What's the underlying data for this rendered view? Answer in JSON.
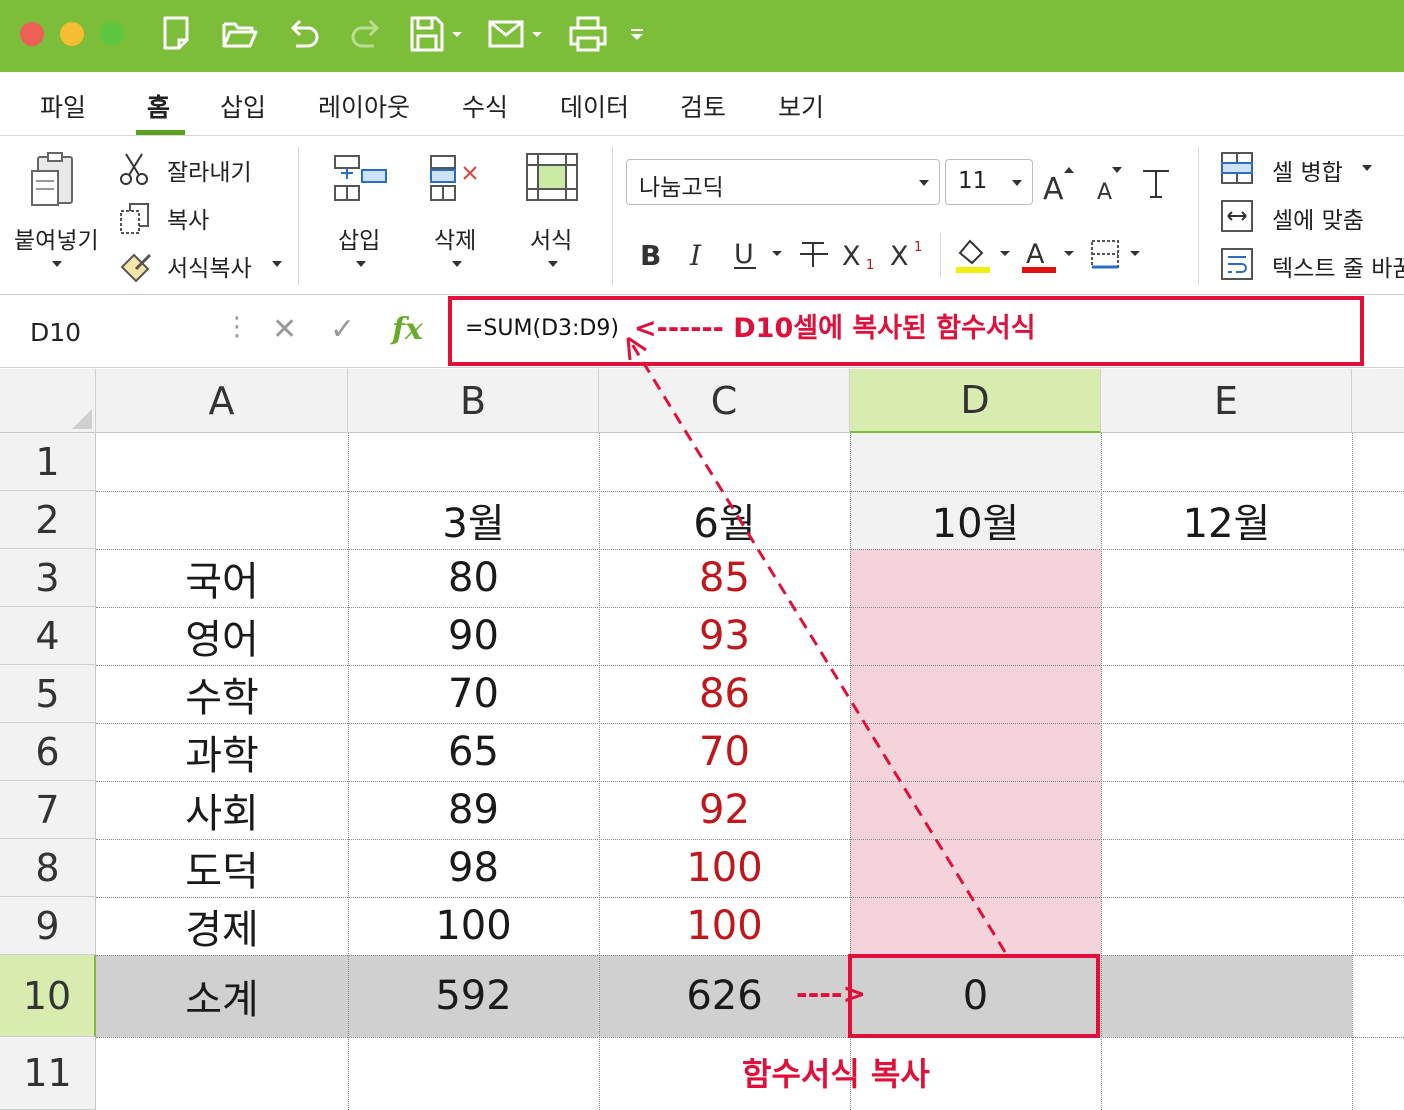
{
  "window": {
    "accent_color": "#7cbe3a",
    "traffic_lights": [
      "#ed5f57",
      "#f5bd31",
      "#5fc73f"
    ],
    "toolbar_icons": [
      "new-document-icon",
      "open-folder-icon",
      "undo-icon",
      "redo-icon",
      "save-icon",
      "mail-icon",
      "print-icon",
      "more-icon"
    ]
  },
  "menu": {
    "tabs": [
      "파일",
      "홈",
      "삽입",
      "레이아웃",
      "수식",
      "데이터",
      "검토",
      "보기"
    ],
    "active": "홈"
  },
  "ribbon": {
    "paste": "붙여넣기",
    "cut": "잘라내기",
    "copy": "복사",
    "format_painter": "서식복사",
    "insert": "삽입",
    "delete": "삭제",
    "format": "서식",
    "font_name": "나눔고딕",
    "font_size": "11",
    "merge": "셀 병합",
    "fit": "셀에 맞춤",
    "wrap": "텍스트 줄 바꿈",
    "font_color": "#e01010",
    "fill_color": "#f2ee10"
  },
  "formula_bar": {
    "cell_ref": "D10",
    "formula": "=SUM(D3:D9)",
    "annotation": "<------ D10셀에 복사된 함수서식"
  },
  "sheet": {
    "columns": [
      "A",
      "B",
      "C",
      "D",
      "E"
    ],
    "rows": [
      "1",
      "2",
      "3",
      "4",
      "5",
      "6",
      "7",
      "8",
      "9",
      "10",
      "11"
    ],
    "headers": {
      "b": "3월",
      "c": "6월",
      "d": "10월",
      "e": "12월"
    },
    "data": [
      {
        "subject": "국어",
        "mar": "80",
        "jun": "85"
      },
      {
        "subject": "영어",
        "mar": "90",
        "jun": "93"
      },
      {
        "subject": "수학",
        "mar": "70",
        "jun": "86"
      },
      {
        "subject": "과학",
        "mar": "65",
        "jun": "70"
      },
      {
        "subject": "사회",
        "mar": "89",
        "jun": "92"
      },
      {
        "subject": "도덕",
        "mar": "98",
        "jun": "100"
      },
      {
        "subject": "경제",
        "mar": "100",
        "jun": "100"
      }
    ],
    "total": {
      "label": "소계",
      "b": "592",
      "c": "626",
      "d": "0"
    },
    "arrow_annotation": "---->",
    "bottom_annotation": "함수서식 복사",
    "selected_column_color": "#d9ecb0",
    "range_fill_color": "#f5d3da",
    "total_row_color": "#d0d0d0"
  }
}
